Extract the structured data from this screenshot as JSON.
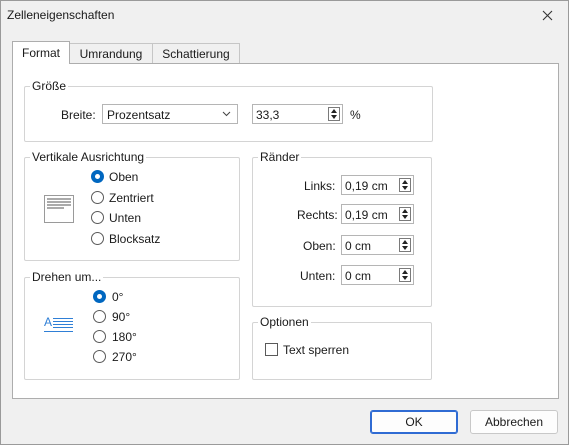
{
  "window": {
    "title": "Zelleneigenschaften"
  },
  "tabs": [
    {
      "label": "Format",
      "active": true
    },
    {
      "label": "Umrandung",
      "active": false
    },
    {
      "label": "Schattierung",
      "active": false
    }
  ],
  "size_group": {
    "title": "Größe",
    "width_label": "Breite:",
    "width_type": "Prozentsatz",
    "width_value": "33,3",
    "unit": "%"
  },
  "vertical_align": {
    "title": "Vertikale Ausrichtung",
    "options": [
      "Oben",
      "Zentriert",
      "Unten",
      "Blocksatz"
    ],
    "selected": "Oben"
  },
  "rotate": {
    "title": "Drehen um...",
    "options": [
      "0°",
      "90°",
      "180°",
      "270°"
    ],
    "selected": "0°",
    "preview_letter": "A"
  },
  "margins": {
    "title": "Ränder",
    "fields": [
      {
        "label": "Links:",
        "value": "0,19 cm"
      },
      {
        "label": "Rechts:",
        "value": "0,19 cm"
      },
      {
        "label": "Oben:",
        "value": "0 cm"
      },
      {
        "label": "Unten:",
        "value": "0 cm"
      }
    ]
  },
  "options": {
    "title": "Optionen",
    "lock_text_label": "Text sperren",
    "lock_text_checked": false
  },
  "buttons": {
    "ok": "OK",
    "cancel": "Abbrechen"
  },
  "colors": {
    "accent": "#0067c0",
    "preview_blue": "#2f7fd6"
  }
}
